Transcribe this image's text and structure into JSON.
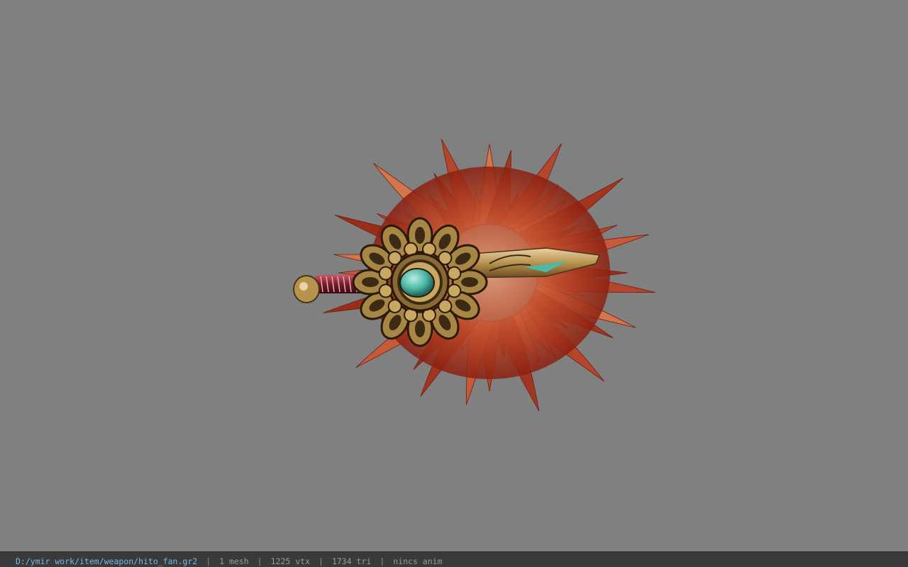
{
  "viewer": {
    "background_color": "#808080",
    "model_icon": "feather-fan-icon"
  },
  "status_bar": {
    "file_path": "D:/ymir work/item/weapon/hito_fan.gr2",
    "separator": "|",
    "mesh_count": "1 mesh",
    "vertex_count": "1225 vtx",
    "triangle_count": "1734 tri",
    "animation": "nincs anim"
  },
  "colors": {
    "feather_dark": "#8a1f10",
    "feather_mid": "#c2502e",
    "feather_light": "#e8a07a",
    "gold": "#b8934e",
    "gold_dark": "#3d2a14",
    "gem": "#4fb8a6",
    "handle": "#7a1a2a",
    "status_path": "#79b8e8"
  }
}
